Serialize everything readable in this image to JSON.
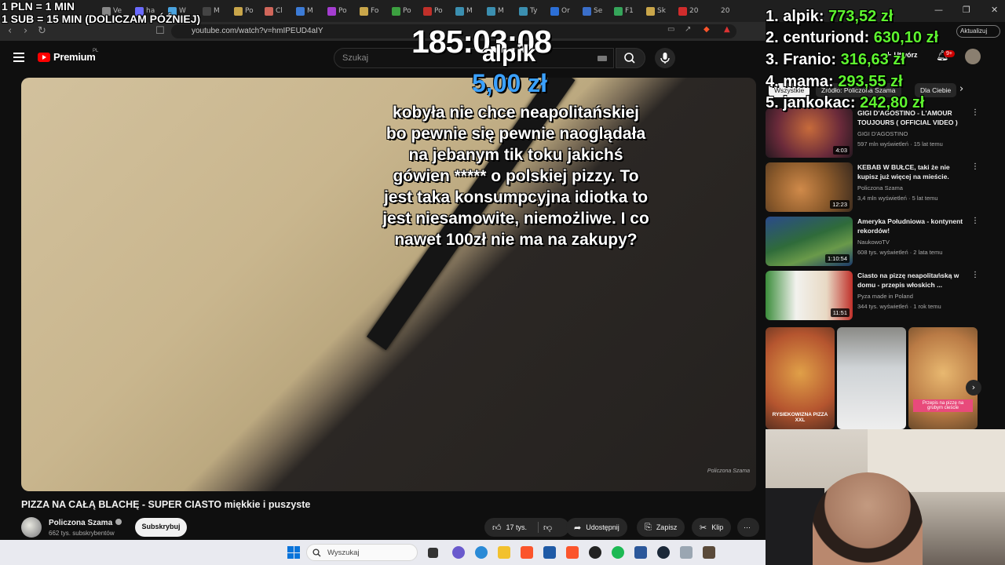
{
  "browser": {
    "url": "youtube.com/watch?v=hmIPEUD4aIY",
    "update_label": "Aktualizuj",
    "tabs": [
      "Ve",
      "ha",
      "W",
      "M",
      "Po",
      "Cl",
      "M",
      "Po",
      "Fo",
      "Po",
      "Po",
      "M",
      "M",
      "Ty",
      "Or",
      "Se",
      "F1",
      "Sk",
      "20",
      "20"
    ]
  },
  "youtube": {
    "logo_text": "Premium",
    "logo_region": "PL",
    "search_placeholder": "Szukaj",
    "create_label": "Utwórz",
    "notif_count": "9+"
  },
  "video": {
    "title": "PIZZA NA CAŁĄ BLACHĘ - SUPER CIASTO miękkie i puszyste",
    "channel": "Policzona Szama",
    "subscribers": "662 tys. subskrybentów",
    "subscribe_label": "Subskrybuj",
    "likes": "17 tys.",
    "share_label": "Udostępnij",
    "save_label": "Zapisz",
    "clip_label": "Klip",
    "more_label": "⋯",
    "watermark": "Policzona Szama"
  },
  "sidebar": {
    "chips": [
      "Wszystkie",
      "Źródło: Policzona Szama",
      "Dla Ciebie"
    ],
    "recommendations": [
      {
        "title": "GIGI D'AGOSTINO - L'AMOUR TOUJOURS ( OFFICIAL VIDEO )",
        "channel": "GIGI D'AGOSTINO",
        "meta": "597 mln wyświetleń · 15 lat temu",
        "duration": "4:03",
        "color": "#6a2a3a"
      },
      {
        "title": "KEBAB W BUŁCE, taki że nie kupisz już więcej na mieście.",
        "channel": "Policzona Szama",
        "meta": "3,4 mln wyświetleń · 5 lat temu",
        "duration": "12:23",
        "color": "#8b5a2b"
      },
      {
        "title": "Ameryka Południowa - kontynent rekordów!",
        "channel": "NaukowoTV",
        "meta": "608 tys. wyświetleń · 2 lata temu",
        "duration": "1:10:54",
        "color": "#2f6b3a"
      },
      {
        "title": "Ciasto na pizzę neapolitańską w domu - przepis włoskich ...",
        "channel": "Pyza made in Poland",
        "meta": "344 tys. wyświetleń · 1 rok temu",
        "duration": "11:51",
        "color": "#3b8d3b"
      }
    ],
    "shorts": [
      {
        "caption": "RYSIEKOWIZNA PIZZA XXL",
        "sticker": "",
        "color": "#b5552f"
      },
      {
        "caption": "",
        "sticker": "",
        "color": "#cfd3d6"
      },
      {
        "caption": "",
        "sticker": "Przepis na pizzę na grubym cieście",
        "color": "#b97a45"
      }
    ]
  },
  "taskbar": {
    "search_placeholder": "Wyszukaj"
  },
  "overlay": {
    "rates": [
      "1 PLN = 1 MIN",
      "1 SUB = 15 MIN (DOLICZAM PÓŹNIEJ)"
    ],
    "timer": "185:03:08",
    "donor": "alpik",
    "amount": "5,00 zł",
    "message": "kobyła nie chce neapolitańskiej bo pewnie się pewnie naoglądała na jebanym tik toku jakichś gówien ***** o polskiej pizzy. To jest taka konsumpcyjna idiotka to jest niesamowite, niemożliwe. I co nawet 100zł nie ma na zakupy?",
    "leaderboard": [
      {
        "name": "1. alpik:",
        "amount": "773,52 zł"
      },
      {
        "name": "2. centuriond:",
        "amount": "630,10 zł"
      },
      {
        "name": "3. Franio:",
        "amount": "316,63 zł"
      },
      {
        "name": "4. mama:",
        "amount": "293,55 zł"
      },
      {
        "name": "5. jankokac:",
        "amount": "242,80 zł"
      }
    ]
  }
}
